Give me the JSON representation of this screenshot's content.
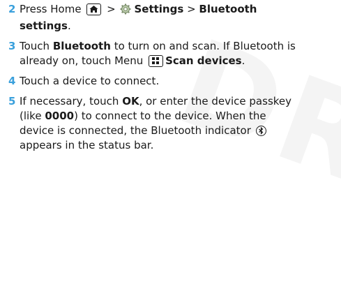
{
  "watermark": "DRAFT",
  "steps": [
    {
      "number": "2",
      "t1": "Press Home",
      "t2": ">",
      "t3": "Settings",
      "t4": ">",
      "t5": "Bluetooth",
      "t6": "settings",
      "t7": "."
    },
    {
      "number": "3",
      "t1": "Touch",
      "t2": "Bluetooth",
      "t3": "to turn on and scan. If Bluetooth is",
      "t4": "already on, touch Menu",
      "t5": "Scan devices",
      "t6": "."
    },
    {
      "number": "4",
      "t1": "Touch a device to connect."
    },
    {
      "number": "5",
      "t1": "If necessary, touch",
      "t2": "OK",
      "t3": ", or enter the device passkey",
      "t4": "(like",
      "t5": "0000",
      "t6": ") to connect to the device. When the",
      "t7": "device is connected, the Bluetooth indicator",
      "t8": "appears in the status bar."
    }
  ],
  "icons": [
    "home-key-icon",
    "settings-gear-icon",
    "menu-key-icon",
    "bluetooth-indicator-icon"
  ]
}
